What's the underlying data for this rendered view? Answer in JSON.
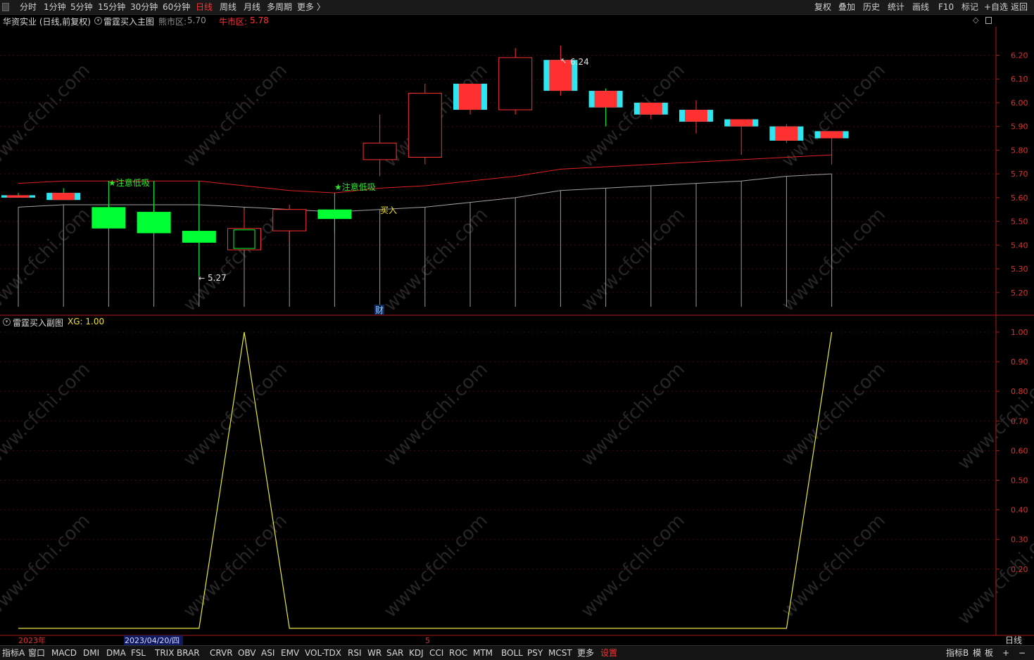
{
  "top_nav": {
    "periods": [
      "分时",
      "1分钟",
      "5分钟",
      "15分钟",
      "30分钟",
      "60分钟",
      "日线",
      "周线",
      "月线",
      "多周期",
      "更多 〉"
    ],
    "active": "日线",
    "tools": [
      "复权",
      "叠加",
      "历史",
      "统计",
      "画线",
      "F10",
      "标记",
      "+自选",
      "返回"
    ]
  },
  "main_chart": {
    "stock": "华资实业 (日线,前复权)",
    "indicator": "雷霆买入主图",
    "bear_label": "熊市区:",
    "bear_value": "5.70",
    "bull_label": "牛市区:",
    "bull_value": "5.78",
    "annotations": {
      "high": "6.24",
      "low": "5.27",
      "signal1": "★注意低吸",
      "signal2": "★注意低吸",
      "buy": "买入",
      "cai": "财"
    },
    "y_ticks": [
      "6.20",
      "6.10",
      "6.00",
      "5.90",
      "5.80",
      "5.70",
      "5.60",
      "5.50",
      "5.40",
      "5.30",
      "5.20"
    ]
  },
  "sub_chart": {
    "indicator": "雷霆买入副图",
    "xg_label": "XG: 1.00",
    "y_ticks": [
      "1.00",
      "0.90",
      "0.80",
      "0.70",
      "0.60",
      "0.50",
      "0.40",
      "0.30",
      "0.20"
    ]
  },
  "x_axis": {
    "year": "2023年",
    "cursor_date": "2023/04/20/四",
    "mid_label": "5",
    "period": "日线"
  },
  "bottom_tabs": {
    "left": "指标A",
    "window": "窗口",
    "indicators": [
      "MACD",
      "DMI",
      "DMA",
      "FSL",
      "TRIX",
      "BRAR",
      "CR",
      "VR",
      "OBV",
      "ASI",
      "EMV",
      "VOL-TDX",
      "RSI",
      "WR",
      "SAR",
      "KDJ",
      "CCI",
      "ROC",
      "MTM",
      "BOLL",
      "PSY",
      "MCST",
      "更多"
    ],
    "settings": "设置",
    "right": [
      "指标B",
      "模",
      "板",
      "+",
      "−"
    ]
  },
  "watermark": "www.cfchi.com",
  "colors": {
    "up": "#ff3030",
    "down": "#00ff33",
    "cyan": "#2ee6f0",
    "ma_red": "#e02020",
    "ma_gray": "#a0a0a0",
    "sub_line": "#e8e840",
    "signal": "#30e830",
    "buy": "#f0e020"
  },
  "chart_data": {
    "type": "candlestick",
    "candles": [
      {
        "o": 5.61,
        "h": 5.62,
        "l": 5.6,
        "c": 5.6,
        "cyan": true
      },
      {
        "o": 5.62,
        "h": 5.64,
        "l": 5.59,
        "c": 5.59,
        "cyan": true
      },
      {
        "o": 5.56,
        "h": 5.67,
        "l": 5.47,
        "c": 5.47
      },
      {
        "o": 5.54,
        "h": 5.67,
        "l": 5.45,
        "c": 5.45
      },
      {
        "o": 5.46,
        "h": 5.67,
        "l": 5.27,
        "c": 5.41
      },
      {
        "o": 5.38,
        "h": 5.55,
        "l": 5.38,
        "c": 5.47,
        "hollow_green": true
      },
      {
        "o": 5.46,
        "h": 5.57,
        "l": 5.41,
        "c": 5.55
      },
      {
        "o": 5.55,
        "h": 5.62,
        "l": 5.45,
        "c": 5.51
      },
      {
        "o": 5.76,
        "h": 5.95,
        "l": 5.69,
        "c": 5.83
      },
      {
        "o": 5.77,
        "h": 6.08,
        "l": 5.74,
        "c": 6.04
      },
      {
        "o": 5.97,
        "h": 6.08,
        "l": 5.95,
        "c": 6.08,
        "cyan": true
      },
      {
        "o": 5.97,
        "h": 6.23,
        "l": 5.95,
        "c": 6.19
      },
      {
        "o": 6.05,
        "h": 6.24,
        "l": 6.03,
        "c": 6.18,
        "cyan": true
      },
      {
        "o": 6.05,
        "h": 6.06,
        "l": 5.9,
        "c": 5.98,
        "cyan": true
      },
      {
        "o": 5.95,
        "h": 6.0,
        "l": 5.93,
        "c": 6.0,
        "cyan": true
      },
      {
        "o": 5.92,
        "h": 6.01,
        "l": 5.87,
        "c": 5.97,
        "cyan": true
      },
      {
        "o": 5.9,
        "h": 5.93,
        "l": 5.78,
        "c": 5.93,
        "cyan": true
      },
      {
        "o": 5.84,
        "h": 5.91,
        "l": 5.83,
        "c": 5.9,
        "cyan": true
      },
      {
        "o": 5.85,
        "h": 5.88,
        "l": 5.74,
        "c": 5.88,
        "cyan": true
      }
    ],
    "red_line": [
      5.66,
      5.67,
      5.67,
      5.67,
      5.67,
      5.65,
      5.63,
      5.62,
      5.64,
      5.65,
      5.67,
      5.69,
      5.72,
      5.73,
      5.74,
      5.75,
      5.76,
      5.77,
      5.78
    ],
    "gray_line": [
      5.56,
      5.57,
      5.57,
      5.57,
      5.57,
      5.56,
      5.55,
      5.54,
      5.55,
      5.56,
      5.58,
      5.6,
      5.63,
      5.64,
      5.65,
      5.66,
      5.67,
      5.69,
      5.7
    ],
    "xg": [
      0,
      0,
      0,
      0,
      0,
      1,
      0,
      0,
      0,
      0,
      0,
      0,
      0,
      0,
      0,
      0,
      0,
      0,
      1
    ],
    "main_ylim": [
      5.14,
      6.32
    ],
    "sub_ylim": [
      0,
      1.0
    ]
  }
}
